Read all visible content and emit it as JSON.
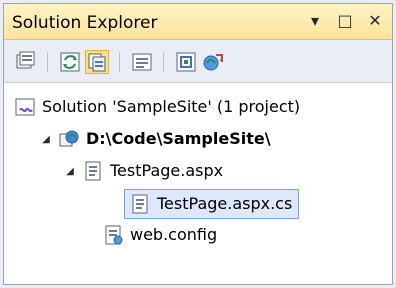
{
  "panel": {
    "title": "Solution Explorer",
    "dropdown_icon": "chevron-down-icon",
    "maximize_icon": "maximize-icon",
    "close_icon": "close-icon"
  },
  "toolbar": {
    "buttons": [
      {
        "name": "properties-icon"
      },
      {
        "name": "refresh-icon"
      },
      {
        "name": "show-all-files-icon",
        "active": true
      },
      {
        "name": "view-code-icon"
      },
      {
        "name": "view-designer-icon"
      },
      {
        "name": "copy-website-icon"
      }
    ]
  },
  "tree": {
    "solution": "Solution 'SampleSite' (1 project)",
    "project": "D:\\Code\\SampleSite\\",
    "page": "TestPage.aspx",
    "codebehind": "TestPage.aspx.cs",
    "config": "web.config"
  }
}
